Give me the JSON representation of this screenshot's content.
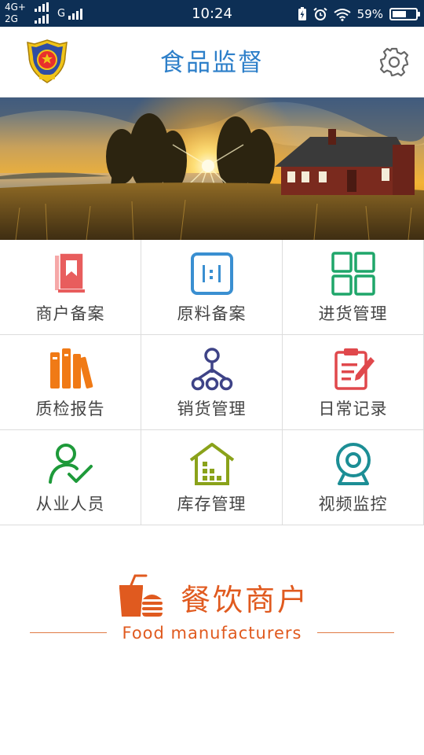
{
  "status_bar": {
    "network_top": "4G+",
    "network_bottom": "2G",
    "network_g": "G",
    "time": "10:24",
    "battery_percent": "59%",
    "battery_level": 0.59,
    "icons": [
      "signal-icon",
      "charging-icon",
      "alarm-icon",
      "wifi-icon",
      "battery-icon"
    ]
  },
  "header": {
    "title": "食品监督",
    "emblem_icon": "police-emblem-icon",
    "settings_icon": "gear-icon"
  },
  "banner": {
    "image": "sunset-lakeside-cabin-photo"
  },
  "menu": {
    "items": [
      {
        "label": "商户备案",
        "icon": "bookmark-book-icon",
        "color": "#e85d5d"
      },
      {
        "label": "原料备案",
        "icon": "barcode-box-icon",
        "color": "#3a8fd1"
      },
      {
        "label": "进货管理",
        "icon": "grid-four-icon",
        "color": "#1fa66a"
      },
      {
        "label": "质检报告",
        "icon": "books-icon",
        "color": "#f07a16"
      },
      {
        "label": "销货管理",
        "icon": "hierarchy-icon",
        "color": "#3e4387"
      },
      {
        "label": "日常记录",
        "icon": "clipboard-pen-icon",
        "color": "#e0484c"
      },
      {
        "label": "从业人员",
        "icon": "user-check-icon",
        "color": "#1e9a3a"
      },
      {
        "label": "库存管理",
        "icon": "warehouse-icon",
        "color": "#8aa21a"
      },
      {
        "label": "视频监控",
        "icon": "webcam-icon",
        "color": "#1c8e95"
      }
    ]
  },
  "brand": {
    "title": "餐饮商户",
    "subtitle": "Food manufacturers",
    "icon": "drink-burger-icon",
    "color": "#e05a1f"
  }
}
